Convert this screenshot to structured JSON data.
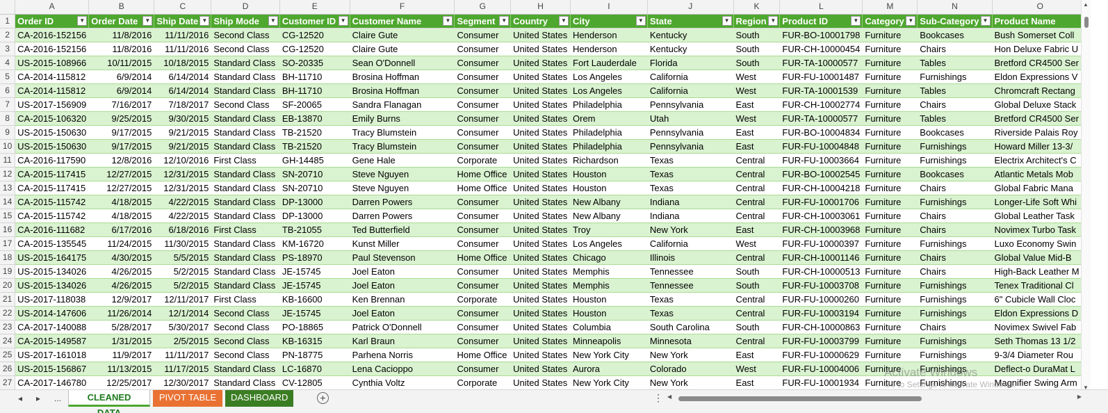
{
  "column_letters": [
    "A",
    "B",
    "C",
    "D",
    "E",
    "F",
    "G",
    "H",
    "I",
    "J",
    "K",
    "L",
    "M",
    "N",
    "O"
  ],
  "headers": [
    "Order ID",
    "Order Date",
    "Ship Date",
    "Ship Mode",
    "Customer ID",
    "Customer Name",
    "Segment",
    "Country",
    "City",
    "State",
    "Region",
    "Product ID",
    "Category",
    "Sub-Category",
    "Product Name"
  ],
  "rows": [
    [
      "CA-2016-152156",
      "11/8/2016",
      "11/11/2016",
      "Second Class",
      "CG-12520",
      "Claire Gute",
      "Consumer",
      "United States",
      "Henderson",
      "Kentucky",
      "South",
      "FUR-BO-10001798",
      "Furniture",
      "Bookcases",
      "Bush Somerset Coll"
    ],
    [
      "CA-2016-152156",
      "11/8/2016",
      "11/11/2016",
      "Second Class",
      "CG-12520",
      "Claire Gute",
      "Consumer",
      "United States",
      "Henderson",
      "Kentucky",
      "South",
      "FUR-CH-10000454",
      "Furniture",
      "Chairs",
      "Hon Deluxe Fabric U"
    ],
    [
      "US-2015-108966",
      "10/11/2015",
      "10/18/2015",
      "Standard Class",
      "SO-20335",
      "Sean O'Donnell",
      "Consumer",
      "United States",
      "Fort Lauderdale",
      "Florida",
      "South",
      "FUR-TA-10000577",
      "Furniture",
      "Tables",
      "Bretford CR4500 Ser"
    ],
    [
      "CA-2014-115812",
      "6/9/2014",
      "6/14/2014",
      "Standard Class",
      "BH-11710",
      "Brosina Hoffman",
      "Consumer",
      "United States",
      "Los Angeles",
      "California",
      "West",
      "FUR-FU-10001487",
      "Furniture",
      "Furnishings",
      "Eldon Expressions V"
    ],
    [
      "CA-2014-115812",
      "6/9/2014",
      "6/14/2014",
      "Standard Class",
      "BH-11710",
      "Brosina Hoffman",
      "Consumer",
      "United States",
      "Los Angeles",
      "California",
      "West",
      "FUR-TA-10001539",
      "Furniture",
      "Tables",
      "Chromcraft Rectang"
    ],
    [
      "US-2017-156909",
      "7/16/2017",
      "7/18/2017",
      "Second Class",
      "SF-20065",
      "Sandra Flanagan",
      "Consumer",
      "United States",
      "Philadelphia",
      "Pennsylvania",
      "East",
      "FUR-CH-10002774",
      "Furniture",
      "Chairs",
      "Global Deluxe Stack"
    ],
    [
      "CA-2015-106320",
      "9/25/2015",
      "9/30/2015",
      "Standard Class",
      "EB-13870",
      "Emily Burns",
      "Consumer",
      "United States",
      "Orem",
      "Utah",
      "West",
      "FUR-TA-10000577",
      "Furniture",
      "Tables",
      "Bretford CR4500 Ser"
    ],
    [
      "US-2015-150630",
      "9/17/2015",
      "9/21/2015",
      "Standard Class",
      "TB-21520",
      "Tracy Blumstein",
      "Consumer",
      "United States",
      "Philadelphia",
      "Pennsylvania",
      "East",
      "FUR-BO-10004834",
      "Furniture",
      "Bookcases",
      "Riverside Palais Roy"
    ],
    [
      "US-2015-150630",
      "9/17/2015",
      "9/21/2015",
      "Standard Class",
      "TB-21520",
      "Tracy Blumstein",
      "Consumer",
      "United States",
      "Philadelphia",
      "Pennsylvania",
      "East",
      "FUR-FU-10004848",
      "Furniture",
      "Furnishings",
      "Howard Miller 13-3/"
    ],
    [
      "CA-2016-117590",
      "12/8/2016",
      "12/10/2016",
      "First Class",
      "GH-14485",
      "Gene Hale",
      "Corporate",
      "United States",
      "Richardson",
      "Texas",
      "Central",
      "FUR-FU-10003664",
      "Furniture",
      "Furnishings",
      "Electrix Architect's C"
    ],
    [
      "CA-2015-117415",
      "12/27/2015",
      "12/31/2015",
      "Standard Class",
      "SN-20710",
      "Steve Nguyen",
      "Home Office",
      "United States",
      "Houston",
      "Texas",
      "Central",
      "FUR-BO-10002545",
      "Furniture",
      "Bookcases",
      "Atlantic Metals Mob"
    ],
    [
      "CA-2015-117415",
      "12/27/2015",
      "12/31/2015",
      "Standard Class",
      "SN-20710",
      "Steve Nguyen",
      "Home Office",
      "United States",
      "Houston",
      "Texas",
      "Central",
      "FUR-CH-10004218",
      "Furniture",
      "Chairs",
      "Global Fabric Mana"
    ],
    [
      "CA-2015-115742",
      "4/18/2015",
      "4/22/2015",
      "Standard Class",
      "DP-13000",
      "Darren Powers",
      "Consumer",
      "United States",
      "New Albany",
      "Indiana",
      "Central",
      "FUR-FU-10001706",
      "Furniture",
      "Furnishings",
      "Longer-Life Soft Whi"
    ],
    [
      "CA-2015-115742",
      "4/18/2015",
      "4/22/2015",
      "Standard Class",
      "DP-13000",
      "Darren Powers",
      "Consumer",
      "United States",
      "New Albany",
      "Indiana",
      "Central",
      "FUR-CH-10003061",
      "Furniture",
      "Chairs",
      "Global Leather Task"
    ],
    [
      "CA-2016-111682",
      "6/17/2016",
      "6/18/2016",
      "First Class",
      "TB-21055",
      "Ted Butterfield",
      "Consumer",
      "United States",
      "Troy",
      "New York",
      "East",
      "FUR-CH-10003968",
      "Furniture",
      "Chairs",
      "Novimex Turbo Task"
    ],
    [
      "CA-2015-135545",
      "11/24/2015",
      "11/30/2015",
      "Standard Class",
      "KM-16720",
      "Kunst Miller",
      "Consumer",
      "United States",
      "Los Angeles",
      "California",
      "West",
      "FUR-FU-10000397",
      "Furniture",
      "Furnishings",
      "Luxo Economy Swin"
    ],
    [
      "US-2015-164175",
      "4/30/2015",
      "5/5/2015",
      "Standard Class",
      "PS-18970",
      "Paul Stevenson",
      "Home Office",
      "United States",
      "Chicago",
      "Illinois",
      "Central",
      "FUR-CH-10001146",
      "Furniture",
      "Chairs",
      "Global Value Mid-B"
    ],
    [
      "US-2015-134026",
      "4/26/2015",
      "5/2/2015",
      "Standard Class",
      "JE-15745",
      "Joel Eaton",
      "Consumer",
      "United States",
      "Memphis",
      "Tennessee",
      "South",
      "FUR-CH-10000513",
      "Furniture",
      "Chairs",
      "High-Back Leather M"
    ],
    [
      "US-2015-134026",
      "4/26/2015",
      "5/2/2015",
      "Standard Class",
      "JE-15745",
      "Joel Eaton",
      "Consumer",
      "United States",
      "Memphis",
      "Tennessee",
      "South",
      "FUR-FU-10003708",
      "Furniture",
      "Furnishings",
      "Tenex Traditional Cl"
    ],
    [
      "US-2017-118038",
      "12/9/2017",
      "12/11/2017",
      "First Class",
      "KB-16600",
      "Ken Brennan",
      "Corporate",
      "United States",
      "Houston",
      "Texas",
      "Central",
      "FUR-FU-10000260",
      "Furniture",
      "Furnishings",
      "6\" Cubicle Wall Cloc"
    ],
    [
      "US-2014-147606",
      "11/26/2014",
      "12/1/2014",
      "Second Class",
      "JE-15745",
      "Joel Eaton",
      "Consumer",
      "United States",
      "Houston",
      "Texas",
      "Central",
      "FUR-FU-10003194",
      "Furniture",
      "Furnishings",
      "Eldon Expressions D"
    ],
    [
      "CA-2017-140088",
      "5/28/2017",
      "5/30/2017",
      "Second Class",
      "PO-18865",
      "Patrick O'Donnell",
      "Consumer",
      "United States",
      "Columbia",
      "South Carolina",
      "South",
      "FUR-CH-10000863",
      "Furniture",
      "Chairs",
      "Novimex Swivel Fab"
    ],
    [
      "CA-2015-149587",
      "1/31/2015",
      "2/5/2015",
      "Second Class",
      "KB-16315",
      "Karl Braun",
      "Consumer",
      "United States",
      "Minneapolis",
      "Minnesota",
      "Central",
      "FUR-FU-10003799",
      "Furniture",
      "Furnishings",
      "Seth Thomas 13 1/2"
    ],
    [
      "US-2017-161018",
      "11/9/2017",
      "11/11/2017",
      "Second Class",
      "PN-18775",
      "Parhena Norris",
      "Home Office",
      "United States",
      "New York City",
      "New York",
      "East",
      "FUR-FU-10000629",
      "Furniture",
      "Furnishings",
      "9-3/4 Diameter Rou"
    ],
    [
      "US-2015-156867",
      "11/13/2015",
      "11/17/2015",
      "Standard Class",
      "LC-16870",
      "Lena Cacioppo",
      "Consumer",
      "United States",
      "Aurora",
      "Colorado",
      "West",
      "FUR-FU-10004006",
      "Furniture",
      "Furnishings",
      "Deflect-o DuraMat L"
    ],
    [
      "CA-2017-146780",
      "12/25/2017",
      "12/30/2017",
      "Standard Class",
      "CV-12805",
      "Cynthia Voltz",
      "Corporate",
      "United States",
      "New York City",
      "New York",
      "East",
      "FUR-FU-10001934",
      "Furniture",
      "Furnishings",
      "Magnifier Swing Arm"
    ]
  ],
  "sheet_tabs": [
    "CLEANED DATA",
    "PIVOT TABLE",
    "DASHBOARD"
  ],
  "tab_nav": {
    "prev": "◂",
    "next": "▸",
    "more": "..."
  },
  "add_sheet_symbol": "+",
  "watermark": {
    "line1": "Activate Windows",
    "line2": "Go to Settings to activate Windows."
  },
  "colors": {
    "header_green": "#4ea72e",
    "band_green": "#d9f2d0",
    "pivot_tab": "#e97132",
    "dashboard_tab": "#3b7d23"
  }
}
